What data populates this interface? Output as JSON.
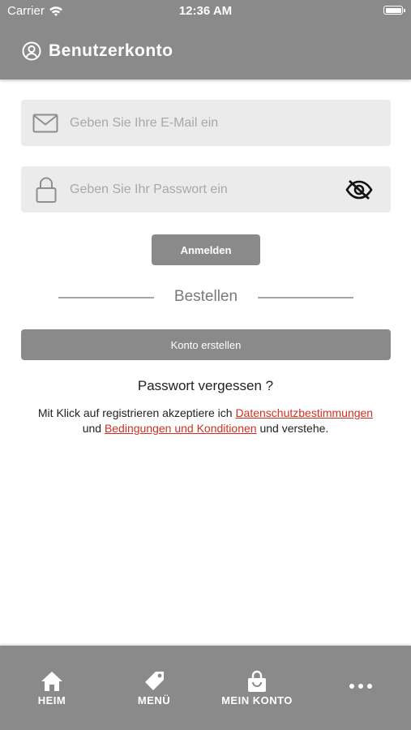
{
  "status_bar": {
    "carrier": "Carrier",
    "time": "12:36 AM",
    "icons": [
      "wifi-icon",
      "battery-icon"
    ]
  },
  "header": {
    "title": "Benutzerkonto",
    "icon": "account-circle-icon"
  },
  "form": {
    "email": {
      "value": "",
      "placeholder": "Geben Sie Ihre E-Mail ein",
      "icon": "mail-icon"
    },
    "password": {
      "value": "",
      "placeholder": "Geben Sie Ihr Passwort ein",
      "icon": "lock-icon",
      "toggle_icon": "eye-off-icon"
    },
    "login_label": "Anmelden",
    "divider_label": "Bestellen",
    "create_account_label": "Konto erstellen",
    "forgot_password": "Passwort vergessen ?",
    "terms": {
      "prefix": "Mit Klick auf registrieren akzeptiere ich ",
      "privacy_link": "Datenschutzbestimmungen",
      "middle": "und ",
      "conditions_link": "Bedingungen und Konditionen",
      "suffix": " und verstehe."
    }
  },
  "tab_bar": {
    "items": [
      {
        "label": "HEIM",
        "icon": "home-icon"
      },
      {
        "label": "MENÜ",
        "icon": "tag-icon"
      },
      {
        "label": "MEIN KONTO",
        "icon": "shopping-bag-icon"
      },
      {
        "label": "",
        "icon": "more-dots-icon"
      }
    ]
  },
  "colors": {
    "bar_gray": "#8a8a8a",
    "field_bg": "#ebebeb",
    "link_red": "#d0301f"
  }
}
